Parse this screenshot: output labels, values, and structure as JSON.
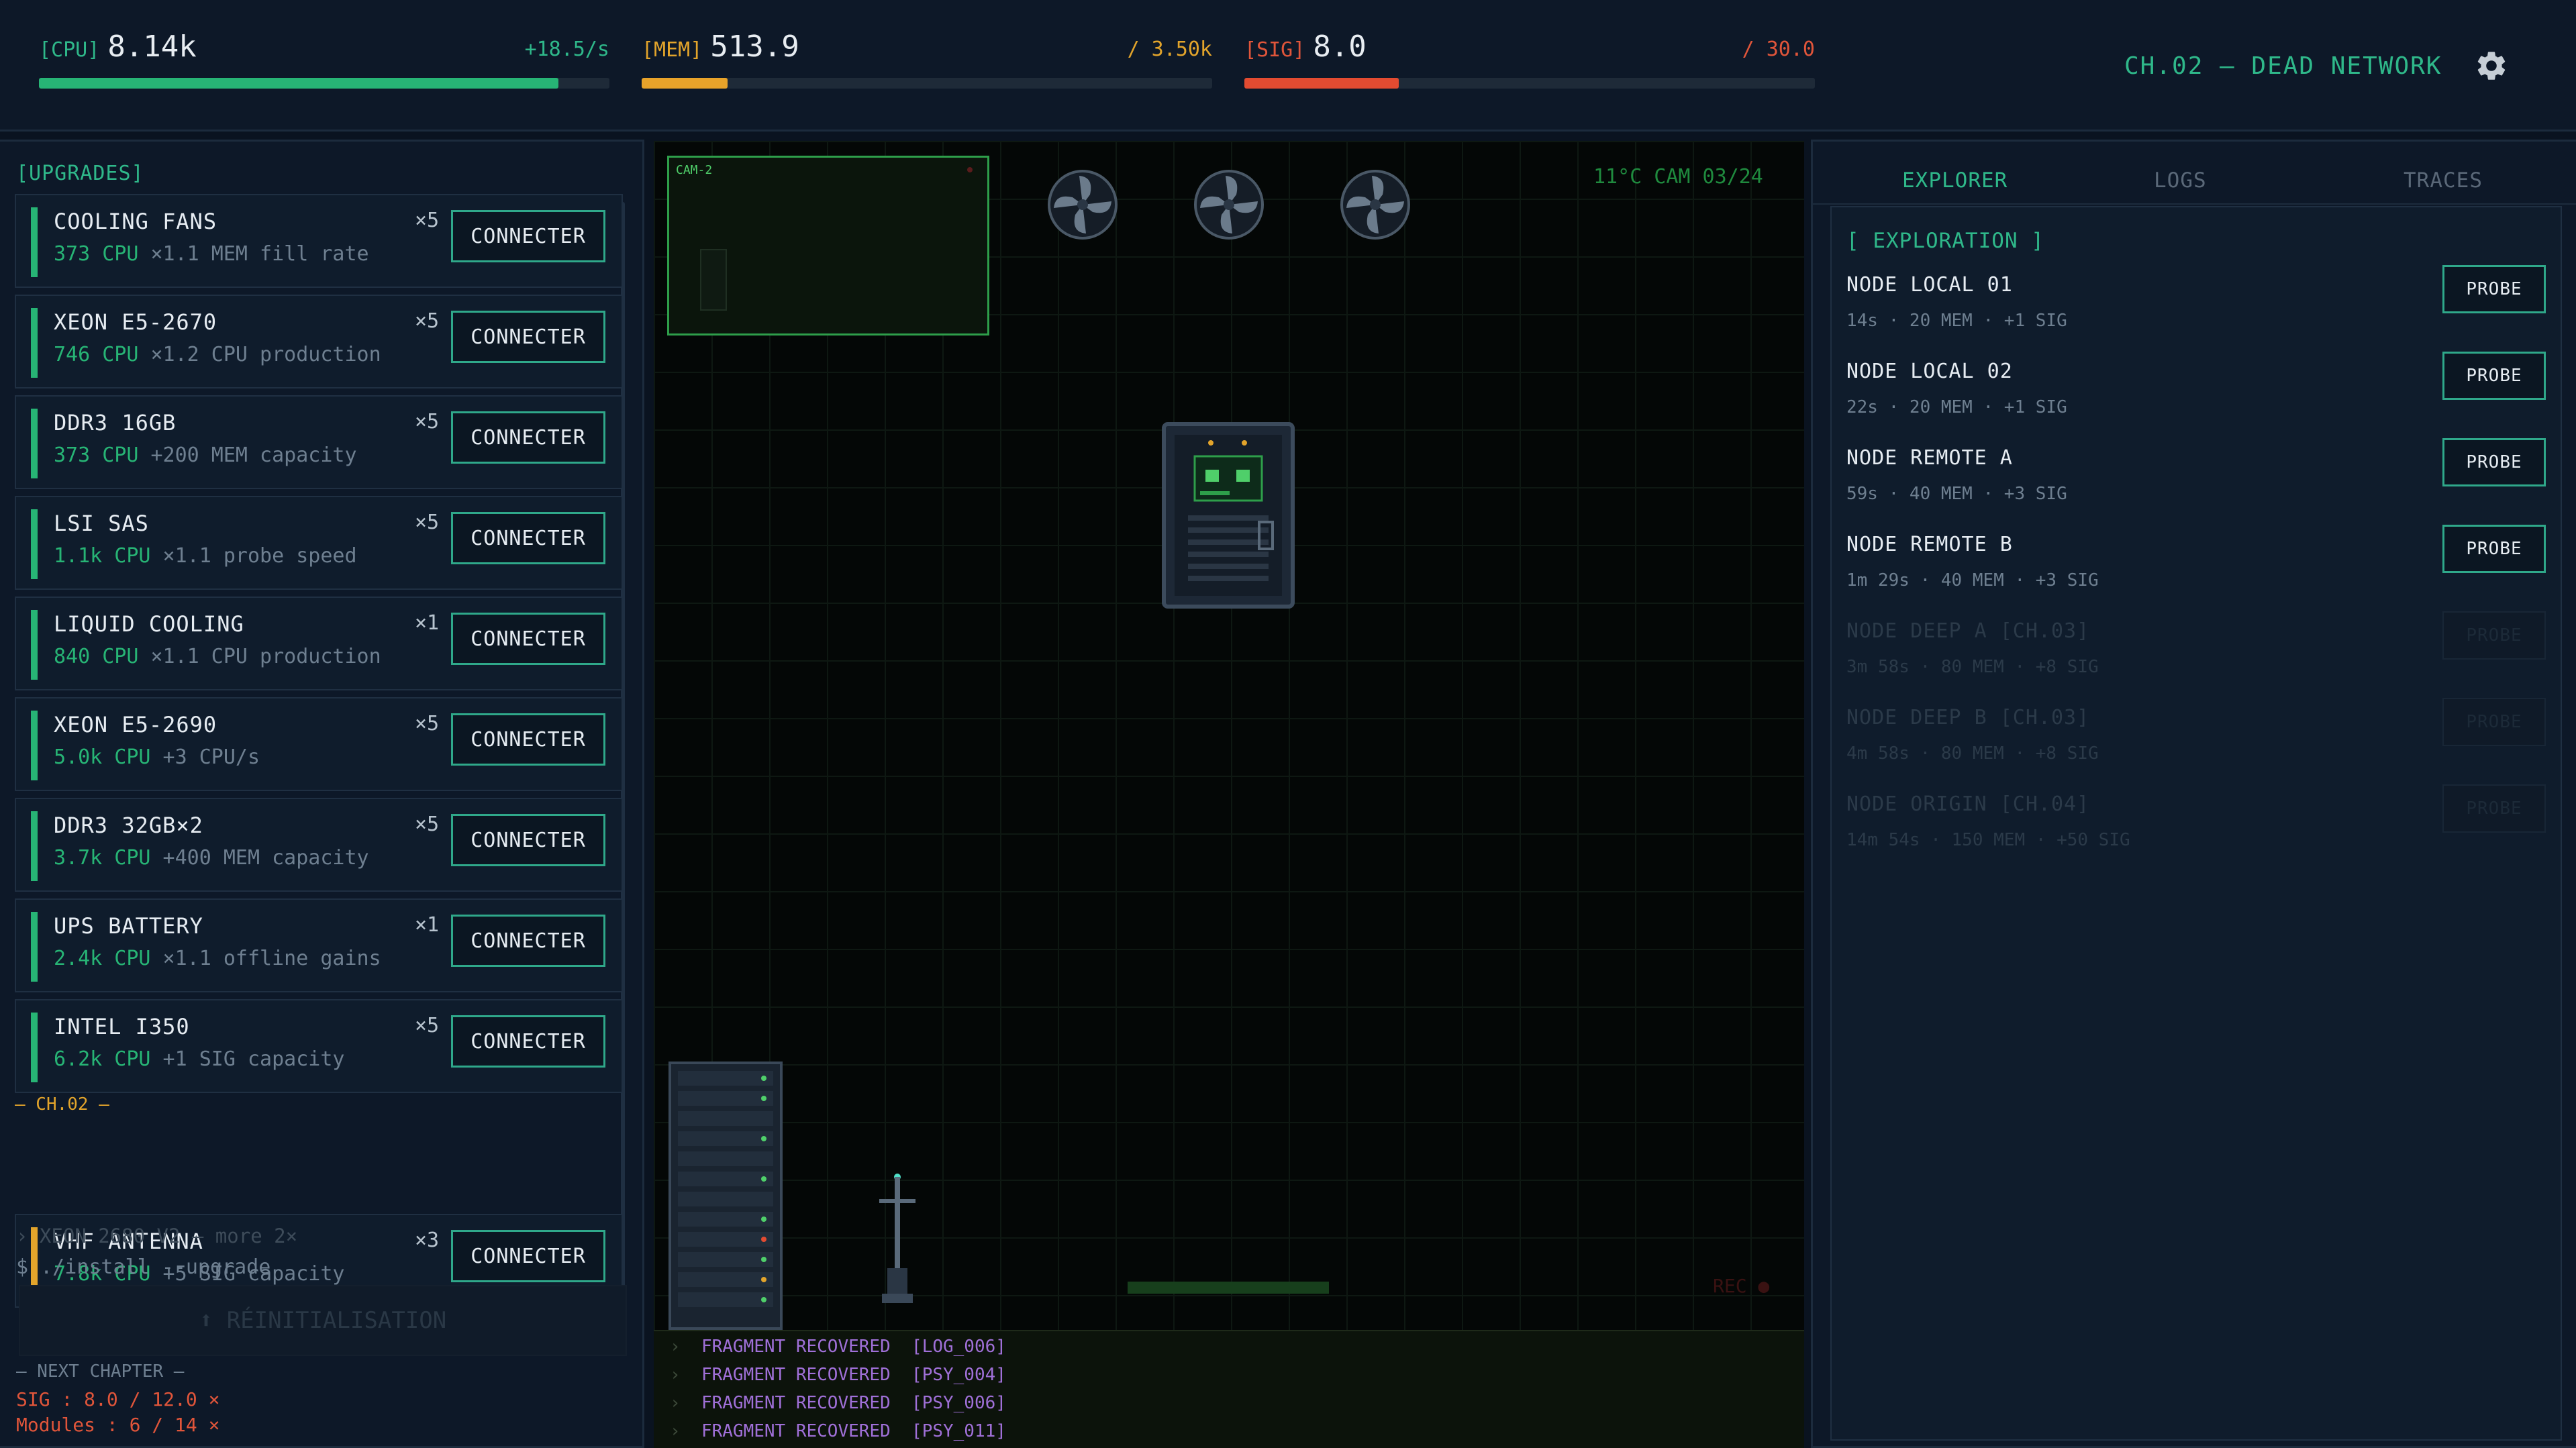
{
  "stats": {
    "cpu": {
      "tag": "[CPU]",
      "value": "8.14k",
      "rate": "+18.5/s",
      "fill_fraction": 0.91
    },
    "mem": {
      "tag": "[MEM]",
      "value": "513.9",
      "cap": "/ 3.50k",
      "fill_fraction": 0.15
    },
    "sig": {
      "tag": "[SIG]",
      "value": "8.0",
      "cap": "/ 30.0",
      "fill_fraction": 0.27
    }
  },
  "chapter_title": "CH.02 — DEAD NETWORK",
  "icons": {
    "settings": "gear-icon",
    "fan": "fan-icon",
    "server": "server-icon",
    "antenna": "antenna-icon"
  },
  "colors": {
    "accent_green": "#27b475",
    "accent_orange": "#e2a42b",
    "accent_red": "#e24b31",
    "log_purple": "#a070d8",
    "cam_green": "#2e9e4a"
  },
  "upgrades": {
    "title": "[UPGRADES]",
    "items": [
      {
        "name": "COOLING FANS",
        "cost": "373 CPU",
        "effect": " ×1.1 MEM fill rate",
        "count": "×5",
        "button": "CONNECTER"
      },
      {
        "name": "XEON E5-2670",
        "cost": "746 CPU",
        "effect": " ×1.2 CPU production",
        "count": "×5",
        "button": "CONNECTER"
      },
      {
        "name": "DDR3 16GB",
        "cost": "373 CPU",
        "effect": " +200 MEM capacity",
        "count": "×5",
        "button": "CONNECTER"
      },
      {
        "name": "LSI SAS",
        "cost": "1.1k CPU",
        "effect": " ×1.1 probe speed",
        "count": "×5",
        "button": "CONNECTER"
      },
      {
        "name": "LIQUID COOLING",
        "cost": "840 CPU",
        "effect": " ×1.1 CPU production",
        "count": "×1",
        "button": "CONNECTER"
      },
      {
        "name": "XEON E5-2690",
        "cost": "5.0k CPU",
        "effect": " +3 CPU/s",
        "count": "×5",
        "button": "CONNECTER"
      },
      {
        "name": "DDR3 32GB×2",
        "cost": "3.7k CPU",
        "effect": " +400 MEM capacity",
        "count": "×5",
        "button": "CONNECTER"
      },
      {
        "name": "UPS BATTERY",
        "cost": "2.4k CPU",
        "effect": " ×1.1 offline gains",
        "count": "×1",
        "button": "CONNECTER"
      },
      {
        "name": "INTEL I350",
        "cost": "6.2k CPU",
        "effect": " +1 SIG capacity",
        "count": "×5",
        "button": "CONNECTER"
      }
    ],
    "ch02_divider": "— CH.02 —",
    "ch02_items": [
      {
        "name": "VHF ANTENNA",
        "cost": "7.8k CPU",
        "effect": " +5 SIG capacity",
        "count": "×3",
        "button": "CONNECTER"
      }
    ],
    "locked_hint": "› XEON 2680 V2 — more 2×",
    "install_cmd": "$ ./install --upgrade",
    "reinit_button": "⬆ RÉINITIALISATION",
    "next_chapter": {
      "label": "— NEXT CHAPTER —",
      "sig_req": "SIG : 8.0 / 12.0 ×",
      "modules_req": "Modules : 6 / 14 ×"
    }
  },
  "scene": {
    "cam_label": "CAM-2",
    "readout": "11°C  CAM 03/24",
    "rec": "REC ●",
    "logs": [
      {
        "bullet": "›",
        "text": "FRAGMENT RECOVERED  [LOG_006]"
      },
      {
        "bullet": "›",
        "text": "FRAGMENT RECOVERED  [PSY_004]"
      },
      {
        "bullet": "›",
        "text": "FRAGMENT RECOVERED  [PSY_006]"
      },
      {
        "bullet": "›",
        "text": "FRAGMENT RECOVERED  [PSY_011]"
      }
    ]
  },
  "explorer": {
    "tabs": [
      "EXPLORER",
      "LOGS",
      "TRACES"
    ],
    "active_tab": "EXPLORER",
    "section_title": "[ EXPLORATION ]",
    "nodes": [
      {
        "name": "NODE LOCAL 01",
        "meta": "14s · 20 MEM · +1 SIG",
        "button": "PROBE",
        "locked": false
      },
      {
        "name": "NODE LOCAL 02",
        "meta": "22s · 20 MEM · +1 SIG",
        "button": "PROBE",
        "locked": false
      },
      {
        "name": "NODE REMOTE A",
        "meta": "59s · 40 MEM · +3 SIG",
        "button": "PROBE",
        "locked": false
      },
      {
        "name": "NODE REMOTE B",
        "meta": "1m 29s · 40 MEM · +3 SIG",
        "button": "PROBE",
        "locked": false
      },
      {
        "name": "NODE DEEP A  [CH.03]",
        "meta": "3m 58s · 80 MEM · +8 SIG",
        "button": "PROBE",
        "locked": true
      },
      {
        "name": "NODE DEEP B  [CH.03]",
        "meta": "4m 58s · 80 MEM · +8 SIG",
        "button": "PROBE",
        "locked": true
      },
      {
        "name": "NODE ORIGIN  [CH.04]",
        "meta": "14m 54s · 150 MEM · +50 SIG",
        "button": "PROBE",
        "locked": true
      }
    ]
  }
}
